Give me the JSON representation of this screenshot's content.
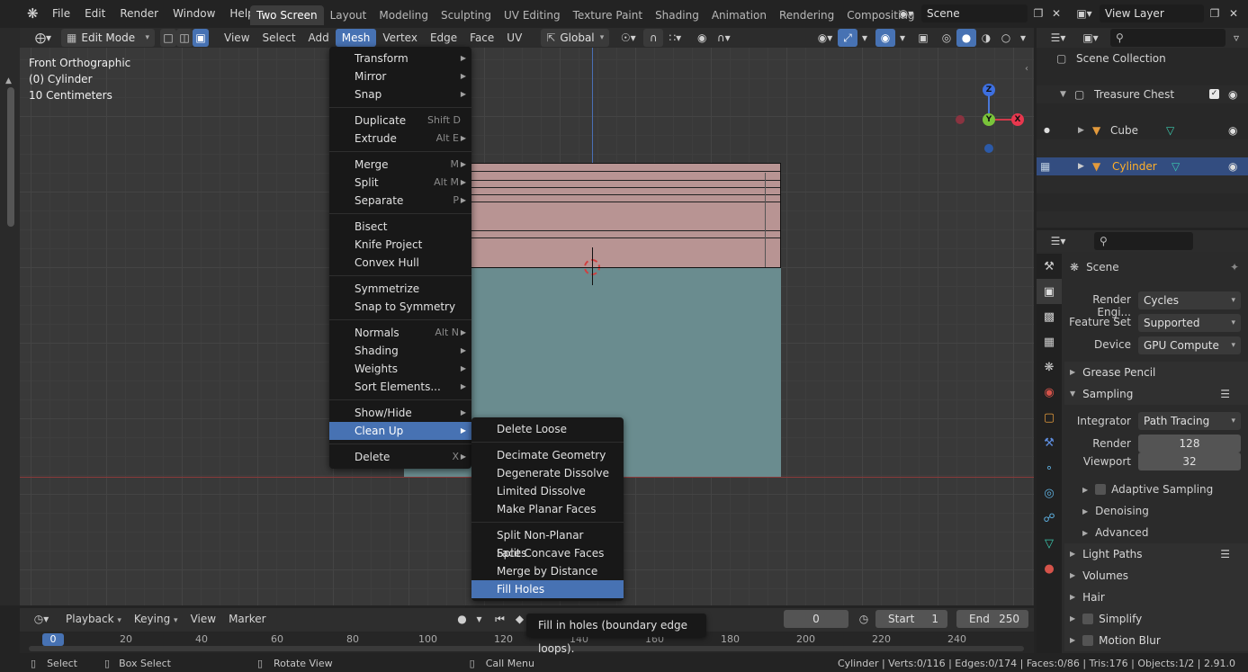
{
  "topbar": {
    "menus": [
      "File",
      "Edit",
      "Render",
      "Window",
      "Help"
    ],
    "workspaces": [
      "Two Screen",
      "Layout",
      "Modeling",
      "Sculpting",
      "UV Editing",
      "Texture Paint",
      "Shading",
      "Animation",
      "Rendering",
      "Compositing"
    ],
    "scene": "Scene",
    "view_layer": "View Layer"
  },
  "vp_header": {
    "mode": "Edit Mode",
    "menus": [
      "View",
      "Select",
      "Add",
      "Mesh",
      "Vertex",
      "Edge",
      "Face",
      "UV"
    ],
    "transform": "Global"
  },
  "overlay": {
    "view": "Front Orthographic",
    "object": "(0) Cylinder",
    "scale": "10 Centimeters"
  },
  "gizmo": {
    "z": "Z",
    "y": "Y",
    "x": "X"
  },
  "mesh_menu": {
    "items": [
      {
        "label": "Transform",
        "shortcut": "",
        "arrow": true
      },
      {
        "label": "Mirror",
        "shortcut": "",
        "arrow": true
      },
      {
        "label": "Snap",
        "shortcut": "",
        "arrow": true
      },
      {
        "label": "Duplicate",
        "shortcut": "Shift D",
        "arrow": false
      },
      {
        "label": "Extrude",
        "shortcut": "Alt E",
        "arrow": true
      },
      {
        "label": "Merge",
        "shortcut": "M",
        "arrow": true
      },
      {
        "label": "Split",
        "shortcut": "Alt M",
        "arrow": true
      },
      {
        "label": "Separate",
        "shortcut": "P",
        "arrow": true
      },
      {
        "label": "Bisect",
        "shortcut": "",
        "arrow": false
      },
      {
        "label": "Knife Project",
        "shortcut": "",
        "arrow": false
      },
      {
        "label": "Convex Hull",
        "shortcut": "",
        "arrow": false
      },
      {
        "label": "Symmetrize",
        "shortcut": "",
        "arrow": false
      },
      {
        "label": "Snap to Symmetry",
        "shortcut": "",
        "arrow": false
      },
      {
        "label": "Normals",
        "shortcut": "Alt N",
        "arrow": true
      },
      {
        "label": "Shading",
        "shortcut": "",
        "arrow": true
      },
      {
        "label": "Weights",
        "shortcut": "",
        "arrow": true
      },
      {
        "label": "Sort Elements...",
        "shortcut": "",
        "arrow": true
      },
      {
        "label": "Show/Hide",
        "shortcut": "",
        "arrow": true
      },
      {
        "label": "Clean Up",
        "shortcut": "",
        "arrow": true
      },
      {
        "label": "Delete",
        "shortcut": "X",
        "arrow": true
      }
    ]
  },
  "cleanup_menu": {
    "items": [
      "Delete Loose",
      "Decimate Geometry",
      "Degenerate Dissolve",
      "Limited Dissolve",
      "Make Planar Faces",
      "Split Non-Planar Faces",
      "Split Concave Faces",
      "Merge by Distance",
      "Fill Holes"
    ]
  },
  "tooltip": "Fill in holes (boundary edge loops).",
  "outliner": {
    "root": "Scene Collection",
    "collection": "Treasure Chest",
    "objects": [
      "Cube",
      "Cylinder"
    ]
  },
  "props": {
    "scene": "Scene",
    "render_engine_label": "Render Engi...",
    "render_engine": "Cycles",
    "feature_set_label": "Feature Set",
    "feature_set": "Supported",
    "device_label": "Device",
    "device": "GPU Compute",
    "grease_pencil": "Grease Pencil",
    "sampling": "Sampling",
    "integrator_label": "Integrator",
    "integrator": "Path Tracing",
    "render_label": "Render",
    "render_value": "128",
    "viewport_label": "Viewport",
    "viewport_value": "32",
    "adaptive": "Adaptive Sampling",
    "denoising": "Denoising",
    "advanced": "Advanced",
    "light_paths": "Light Paths",
    "volumes": "Volumes",
    "hair": "Hair",
    "simplify": "Simplify",
    "motion_blur": "Motion Blur"
  },
  "timeline": {
    "menus": [
      "Playback",
      "Keying",
      "View",
      "Marker"
    ],
    "current_frame": "0",
    "start_label": "Start",
    "start": "1",
    "end_label": "End",
    "end": "250",
    "ruler": [
      "0",
      "20",
      "40",
      "60",
      "80",
      "100",
      "120",
      "140",
      "160",
      "180",
      "200",
      "220",
      "240"
    ]
  },
  "status": {
    "select": "Select",
    "box_select": "Box Select",
    "rotate": "Rotate View",
    "call_menu": "Call Menu",
    "stats": "Cylinder | Verts:0/116 | Edges:0/174 | Faces:0/86 | Tris:176 | Objects:1/2 | 2.91.0"
  }
}
